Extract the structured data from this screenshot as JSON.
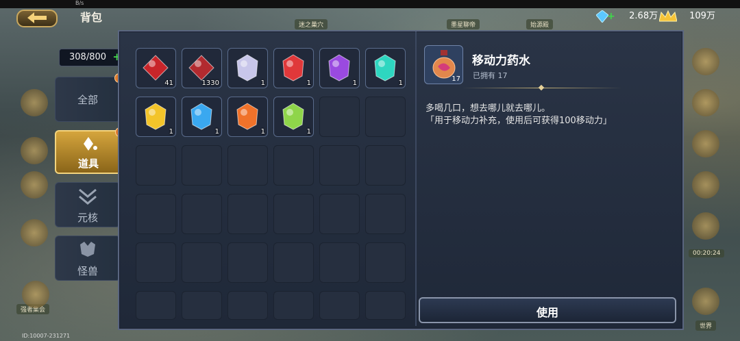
{
  "status": {
    "net": "B/s"
  },
  "header": {
    "title": "背包"
  },
  "resources": {
    "crystal": "2.68万",
    "gold": "109万"
  },
  "capacity": {
    "text": "308/800"
  },
  "tabs": [
    {
      "label": "全部",
      "active": false
    },
    {
      "label": "道具",
      "active": true
    },
    {
      "label": "元核",
      "active": false
    },
    {
      "label": "怪兽",
      "active": false
    }
  ],
  "items": [
    {
      "name": "red-sword-item",
      "qty": "41",
      "color": "#c8252a"
    },
    {
      "name": "red-mask-item",
      "qty": "1330",
      "color": "#b22a2f"
    },
    {
      "name": "white-rose-gem",
      "qty": "1",
      "color": "#c8c6ea"
    },
    {
      "name": "red-crystal-gem",
      "qty": "1",
      "color": "#e0383a"
    },
    {
      "name": "purple-crystal-gem",
      "qty": "1",
      "color": "#9a4ae0"
    },
    {
      "name": "cyan-crystal-gem",
      "qty": "1",
      "color": "#2ed6c0"
    },
    {
      "name": "gold-leaf-gem",
      "qty": "1",
      "color": "#f3c42a"
    },
    {
      "name": "blue-leaf-gem",
      "qty": "1",
      "color": "#3aa8f0"
    },
    {
      "name": "orange-leaf-gem",
      "qty": "1",
      "color": "#f0722a"
    },
    {
      "name": "green-leaf-gem",
      "qty": "1",
      "color": "#8fd54a"
    }
  ],
  "detail": {
    "name": "移动力药水",
    "qty": "17",
    "owned": "已拥有 17",
    "desc_line1": "多喝几口，想去哪儿就去哪儿。",
    "desc_line2": "「用于移动力补充，使用后可获得100移动力」"
  },
  "use_button": "使用",
  "background": {
    "user_id": "ID:10007-231271",
    "label1": "迷之巢穴",
    "label2": "墨星聊帝",
    "label3": "始源殿",
    "timer": "00:20:24",
    "world": "世界",
    "player": "强者集会"
  }
}
